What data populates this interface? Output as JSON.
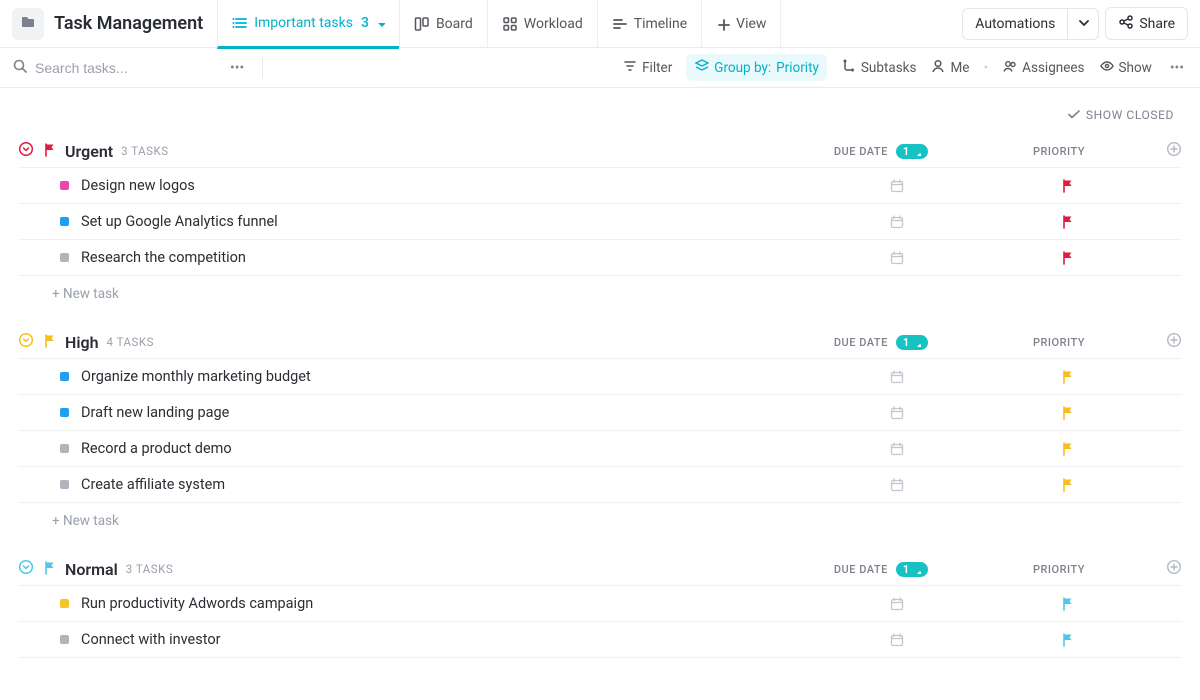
{
  "header": {
    "title": "Task Management",
    "tabs": {
      "important": {
        "label": "Important tasks",
        "count": "3"
      },
      "board": {
        "label": "Board"
      },
      "workload": {
        "label": "Workload"
      },
      "timeline": {
        "label": "Timeline"
      },
      "view": {
        "label": "View"
      }
    },
    "automations": "Automations",
    "share": "Share"
  },
  "toolbar": {
    "search_placeholder": "Search tasks...",
    "filter": "Filter",
    "group_by_prefix": "Group by:",
    "group_by_value": "Priority",
    "subtasks": "Subtasks",
    "me": "Me",
    "assignees": "Assignees",
    "show": "Show"
  },
  "show_closed": "SHOW CLOSED",
  "col": {
    "due": "DUE DATE",
    "priority": "PRIORITY",
    "badge": "1"
  },
  "new_task_label": "+ New task",
  "groups": [
    {
      "id": "urgent",
      "title": "Urgent",
      "count_label": "3 TASKS",
      "flag_class": "flag-red",
      "chevron_class": "circle-chevron-red",
      "tasks": [
        {
          "name": "Design new logos",
          "status_class": "c-pink",
          "flag_class": "flag-red"
        },
        {
          "name": "Set up Google Analytics funnel",
          "status_class": "c-blue",
          "flag_class": "flag-red"
        },
        {
          "name": "Research the competition",
          "status_class": "c-grey",
          "flag_class": "flag-red"
        }
      ]
    },
    {
      "id": "high",
      "title": "High",
      "count_label": "4 TASKS",
      "flag_class": "flag-yellow",
      "chevron_class": "circle-chevron-yellow",
      "tasks": [
        {
          "name": "Organize monthly marketing budget",
          "status_class": "c-blue",
          "flag_class": "flag-yellow"
        },
        {
          "name": "Draft new landing page",
          "status_class": "c-blue",
          "flag_class": "flag-yellow"
        },
        {
          "name": "Record a product demo",
          "status_class": "c-grey",
          "flag_class": "flag-yellow"
        },
        {
          "name": "Create affiliate system",
          "status_class": "c-grey",
          "flag_class": "flag-yellow"
        }
      ]
    },
    {
      "id": "normal",
      "title": "Normal",
      "count_label": "3 TASKS",
      "flag_class": "flag-blue",
      "chevron_class": "circle-chevron-blue",
      "tasks": [
        {
          "name": "Run productivity Adwords campaign",
          "status_class": "c-gold",
          "flag_class": "flag-blue"
        },
        {
          "name": "Connect with investor",
          "status_class": "c-grey",
          "flag_class": "flag-blue"
        }
      ]
    }
  ]
}
